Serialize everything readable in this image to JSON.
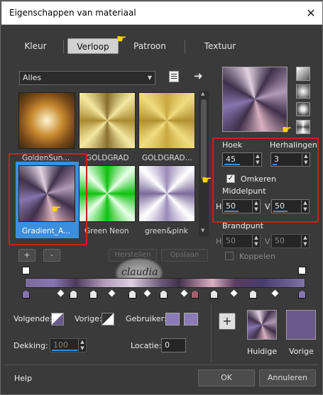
{
  "window": {
    "title": "Eigenschappen van materiaal"
  },
  "tabs": [
    {
      "label": "Kleur",
      "selected": false
    },
    {
      "label": "Verloop",
      "selected": true
    },
    {
      "label": "Patroon",
      "selected": false
    },
    {
      "label": "Textuur",
      "selected": false
    }
  ],
  "gallery": {
    "filter": "Alles",
    "items": [
      {
        "label": "GoldenSun...",
        "selected": false
      },
      {
        "label": "GOLDGRAD",
        "selected": false
      },
      {
        "label": "GOLDGRAD...",
        "selected": false
      },
      {
        "label": "Gradient_A...",
        "selected": true
      },
      {
        "label": "Green Neon",
        "selected": false
      },
      {
        "label": "green&pink",
        "selected": false
      }
    ],
    "add_label": "+",
    "remove_label": "-",
    "restore_label": "Herstellen",
    "save_label": "Opslaan"
  },
  "settings": {
    "angle_label": "Hoek",
    "angle_value": "45",
    "repeats_label": "Herhalingen",
    "repeats_value": "3",
    "reverse_label": "Omkeren",
    "reverse_checked": true,
    "midpoint_label": "Middelpunt",
    "mid_h_label": "H",
    "mid_h_value": "50",
    "mid_v_label": "V",
    "mid_v_value": "50",
    "focal_label": "Brandpunt",
    "focal_h_label": "H",
    "focal_h_value": "50",
    "focal_v_label": "V",
    "focal_v_value": "50",
    "link_label": "Koppelen",
    "link_checked": false
  },
  "watermark": {
    "text": "claudia"
  },
  "stops": {
    "next_label": "Volgende:",
    "prev_label": "Vorige:",
    "user_label": "Gebruiker:",
    "opacity_label": "Dekking:",
    "opacity_value": "100",
    "location_label": "Locatie:",
    "location_value": "0",
    "user_colors": [
      "#8a7ab8",
      "#8a7ab8"
    ]
  },
  "preview": {
    "current_label": "Huidige",
    "previous_label": "Vorige",
    "add_label": "+",
    "previous_color": "#6a5a8c"
  },
  "footer": {
    "help_label": "Help",
    "ok_label": "OK",
    "cancel_label": "Annuleren"
  },
  "colors": {
    "selection": "#3b8fdc",
    "highlight": "#d41c1c"
  }
}
